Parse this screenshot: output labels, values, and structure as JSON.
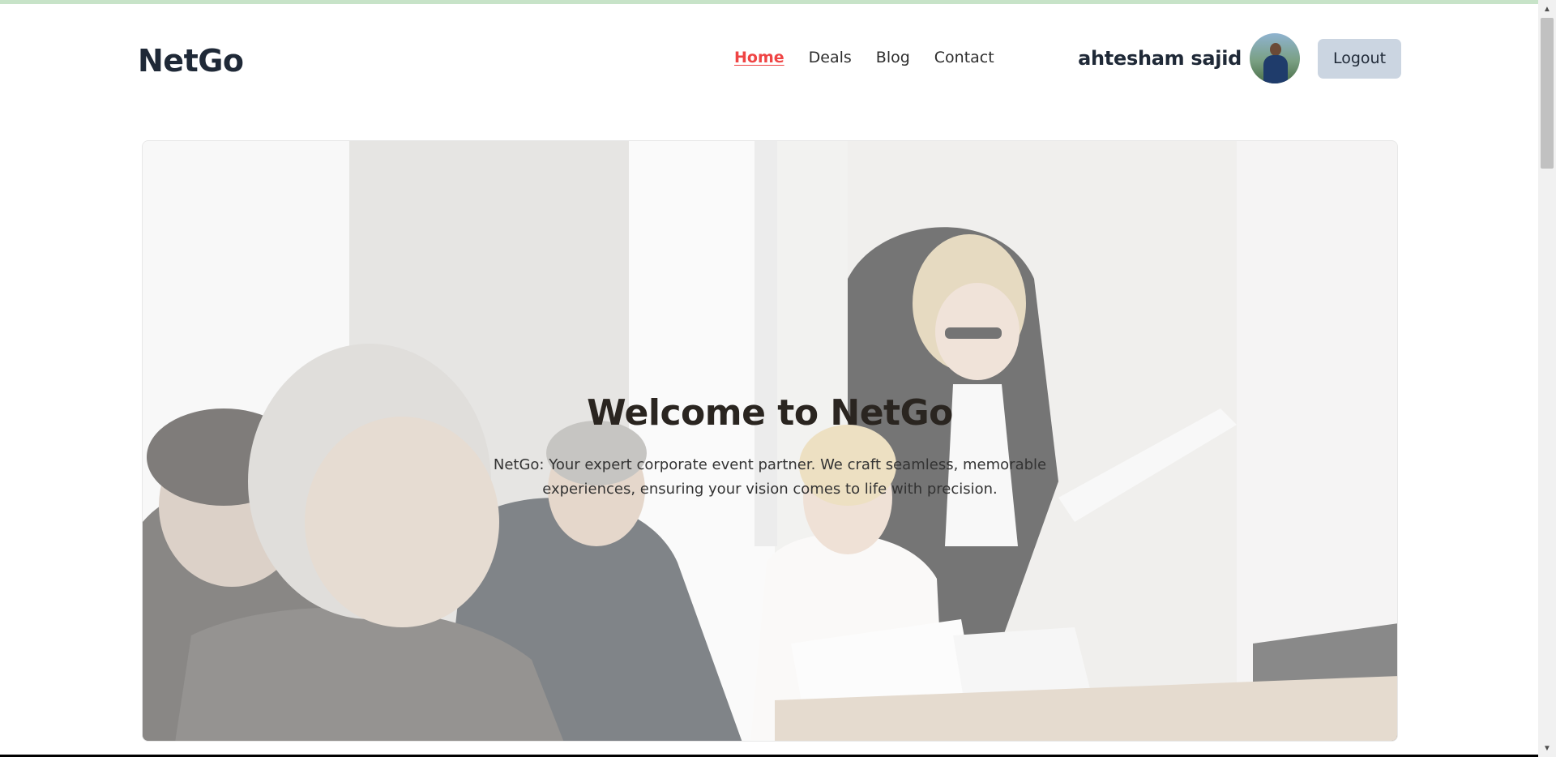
{
  "header": {
    "logo": "NetGo",
    "nav": [
      "Home",
      "Deals",
      "Blog",
      "Contact"
    ],
    "active_nav": "Home",
    "username": "ahtesham sajid",
    "logout_label": "Logout"
  },
  "hero": {
    "title": "Welcome to NetGo",
    "description": "NetGo: Your expert corporate event partner. We craft seamless, memorable experiences, ensuring your vision comes to life with precision."
  },
  "colors": {
    "active_nav": "#ef4444",
    "logout_bg": "#cbd5e1",
    "top_strip": "#c7e3c8"
  },
  "icons": {
    "avatar": "user-avatar-photo",
    "scroll_up": "scroll-up-arrow-icon",
    "scroll_down": "scroll-down-arrow-icon"
  }
}
